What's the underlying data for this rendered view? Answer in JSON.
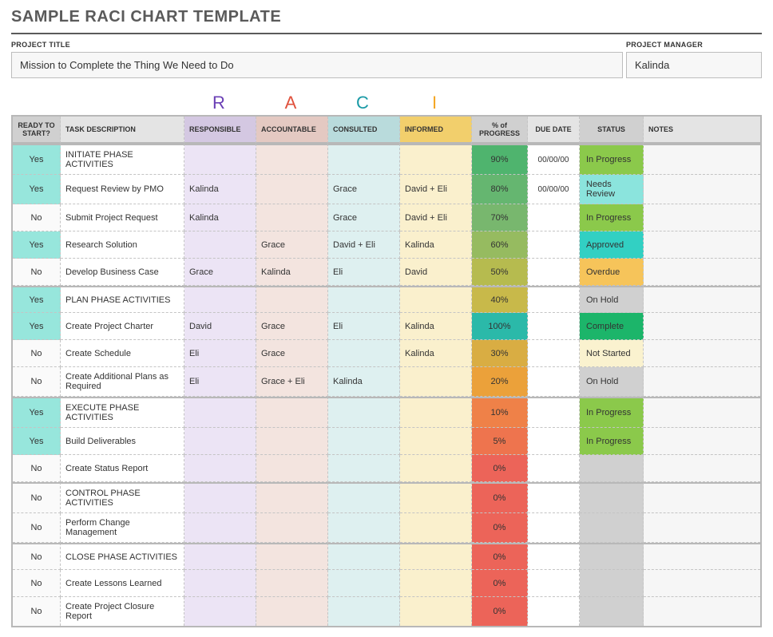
{
  "title": "SAMPLE RACI CHART TEMPLATE",
  "meta": {
    "project_label": "PROJECT TITLE",
    "project_value": "Mission to Complete the Thing We Need to Do",
    "manager_label": "PROJECT MANAGER",
    "manager_value": "Kalinda"
  },
  "letters": {
    "R": "R",
    "A": "A",
    "C": "C",
    "I": "I"
  },
  "headers": {
    "ready": "READY TO START?",
    "task": "TASK DESCRIPTION",
    "responsible": "RESPONSIBLE",
    "accountable": "ACCOUNTABLE",
    "consulted": "CONSULTED",
    "informed": "INFORMED",
    "progress": "% of PROGRESS",
    "due": "DUE DATE",
    "status": "STATUS",
    "notes": "NOTES"
  },
  "progress_colors": {
    "100": "#2bb9a9",
    "90": "#4fb46e",
    "80": "#65b670",
    "70": "#78b76e",
    "60": "#96bb60",
    "50": "#b6bb4f",
    "40": "#c8b94a",
    "30": "#d9ad43",
    "20": "#eba13a",
    "10": "#ef8148",
    "5": "#ee744e",
    "0": "#ec6459"
  },
  "status_colors": {
    "In Progress": "#8bc94b",
    "Needs Review": "#8be4dd",
    "Approved": "#32d0c3",
    "Overdue": "#f6c45a",
    "On Hold": "#d0d0d0",
    "Complete": "#1cb56a",
    "Not Started": "#faf2cf",
    "": "#d0d0d0"
  },
  "rows": [
    {
      "section": true,
      "ready": "Yes",
      "task": "INITIATE PHASE ACTIVITIES",
      "r": "",
      "a": "",
      "c": "",
      "i": "",
      "progress": "90%",
      "pkey": "90",
      "due": "00/00/00",
      "status": "In Progress"
    },
    {
      "ready": "Yes",
      "task": "Request Review by PMO",
      "r": "Kalinda",
      "a": "",
      "c": "Grace",
      "i": "David + Eli",
      "progress": "80%",
      "pkey": "80",
      "due": "00/00/00",
      "status": "Needs Review"
    },
    {
      "ready": "No",
      "task": "Submit Project Request",
      "r": "Kalinda",
      "a": "",
      "c": "Grace",
      "i": "David + Eli",
      "progress": "70%",
      "pkey": "70",
      "due": "",
      "status": "In Progress"
    },
    {
      "ready": "Yes",
      "task": "Research Solution",
      "r": "",
      "a": "Grace",
      "c": "David + Eli",
      "i": "Kalinda",
      "progress": "60%",
      "pkey": "60",
      "due": "",
      "status": "Approved"
    },
    {
      "ready": "No",
      "task": "Develop Business Case",
      "r": "Grace",
      "a": "Kalinda",
      "c": "Eli",
      "i": "David",
      "progress": "50%",
      "pkey": "50",
      "due": "",
      "status": "Overdue"
    },
    {
      "section": true,
      "ready": "Yes",
      "task": "PLAN PHASE ACTIVITIES",
      "r": "",
      "a": "",
      "c": "",
      "i": "",
      "progress": "40%",
      "pkey": "40",
      "due": "",
      "status": "On Hold"
    },
    {
      "ready": "Yes",
      "task": "Create Project Charter",
      "r": "David",
      "a": "Grace",
      "c": "Eli",
      "i": "Kalinda",
      "progress": "100%",
      "pkey": "100",
      "due": "",
      "status": "Complete"
    },
    {
      "ready": "No",
      "task": "Create Schedule",
      "r": "Eli",
      "a": "Grace",
      "c": "",
      "i": "Kalinda",
      "progress": "30%",
      "pkey": "30",
      "due": "",
      "status": "Not Started"
    },
    {
      "ready": "No",
      "task": "Create Additional Plans as Required",
      "r": "Eli",
      "a": "Grace + Eli",
      "c": "Kalinda",
      "i": "",
      "progress": "20%",
      "pkey": "20",
      "due": "",
      "status": "On Hold"
    },
    {
      "section": true,
      "ready": "Yes",
      "task": "EXECUTE PHASE ACTIVITIES",
      "r": "",
      "a": "",
      "c": "",
      "i": "",
      "progress": "10%",
      "pkey": "10",
      "due": "",
      "status": "In Progress"
    },
    {
      "ready": "Yes",
      "task": "Build Deliverables",
      "r": "",
      "a": "",
      "c": "",
      "i": "",
      "progress": "5%",
      "pkey": "5",
      "due": "",
      "status": "In Progress"
    },
    {
      "ready": "No",
      "task": "Create Status Report",
      "r": "",
      "a": "",
      "c": "",
      "i": "",
      "progress": "0%",
      "pkey": "0",
      "due": "",
      "status": ""
    },
    {
      "section": true,
      "ready": "No",
      "task": "CONTROL PHASE ACTIVITIES",
      "r": "",
      "a": "",
      "c": "",
      "i": "",
      "progress": "0%",
      "pkey": "0",
      "due": "",
      "status": ""
    },
    {
      "ready": "No",
      "task": "Perform Change Management",
      "r": "",
      "a": "",
      "c": "",
      "i": "",
      "progress": "0%",
      "pkey": "0",
      "due": "",
      "status": ""
    },
    {
      "section": true,
      "ready": "No",
      "task": "CLOSE PHASE ACTIVITIES",
      "r": "",
      "a": "",
      "c": "",
      "i": "",
      "progress": "0%",
      "pkey": "0",
      "due": "",
      "status": ""
    },
    {
      "ready": "No",
      "task": "Create Lessons Learned",
      "r": "",
      "a": "",
      "c": "",
      "i": "",
      "progress": "0%",
      "pkey": "0",
      "due": "",
      "status": ""
    },
    {
      "ready": "No",
      "task": "Create Project Closure Report",
      "r": "",
      "a": "",
      "c": "",
      "i": "",
      "progress": "0%",
      "pkey": "0",
      "due": "",
      "status": ""
    }
  ]
}
